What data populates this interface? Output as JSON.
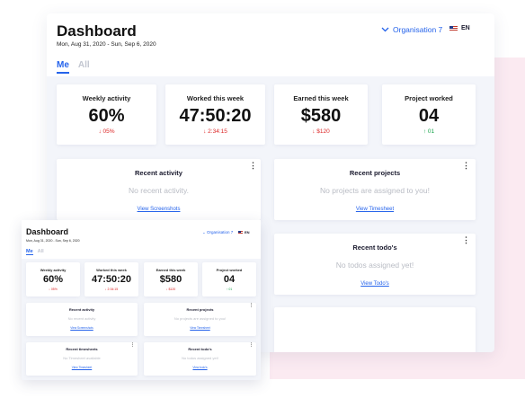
{
  "dashboard": {
    "title": "Dashboard",
    "date_range": "Mon, Aug 31, 2020 - Sun, Sep 6, 2020",
    "organisation": "Organisation 7",
    "language": "EN",
    "tabs": {
      "me": "Me",
      "all": "All"
    },
    "stats": [
      {
        "label": "Weekly activity",
        "value": "60%",
        "change": "↓ 05%",
        "trend": "down"
      },
      {
        "label": "Worked this week",
        "value": "47:50:20",
        "change": "↓ 2:34:15",
        "trend": "down"
      },
      {
        "label": "Earned this week",
        "value": "$580",
        "change": "↓ $120",
        "trend": "down"
      },
      {
        "label": "Project worked",
        "value": "04",
        "change": "↑ 01",
        "trend": "up"
      }
    ],
    "panels": {
      "recent_activity": {
        "title": "Recent activity",
        "empty": "No recent activity.",
        "link": "View Screenshots"
      },
      "recent_projects": {
        "title": "Recent projects",
        "empty": "No projects are assigned to you!",
        "link": "View Timesheet"
      },
      "recent_todos": {
        "title": "Recent todo's",
        "empty": "No todos assigned yet!",
        "link": "View Todo's"
      },
      "recent_timesheets": {
        "title": "Recent timesheets",
        "empty": "No Timesheet available",
        "link": "View Timesheet"
      }
    },
    "small": {
      "recent_activity_empty": "No recent activity",
      "recent_projects_empty": "No projects are assigned to you!",
      "recent_todos_empty": "No todos assigned yet!",
      "recent_todos_link": "View todo's"
    },
    "icons": {
      "org_dropdown": "chevron-down-icon",
      "flag": "us-flag-icon",
      "menu": "more-vertical-icon"
    },
    "colors": {
      "accent": "#2563eb",
      "down": "#dc2626",
      "up": "#16a34a"
    }
  }
}
